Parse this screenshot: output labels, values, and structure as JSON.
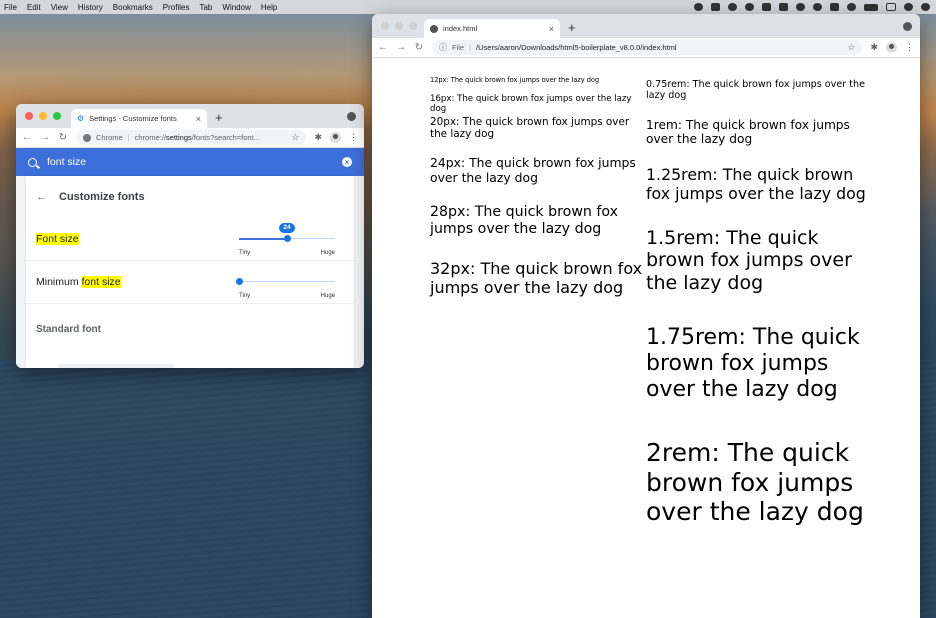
{
  "menubar": {
    "items": [
      "File",
      "Edit",
      "View",
      "History",
      "Bookmarks",
      "Profiles",
      "Tab",
      "Window",
      "Help"
    ],
    "status_icons": [
      "screen-share-icon",
      "dropbox-icon",
      "creative-cloud-icon",
      "gear-icon",
      "app-icon",
      "app-icon",
      "brightness-icon",
      "play-icon",
      "bluetooth-icon",
      "wifi-icon",
      "battery-icon",
      "control-center-icon",
      "search-icon",
      "avatar-icon"
    ]
  },
  "settings_window": {
    "tab_title": "Settings - Customize fonts",
    "omnibox_scheme": "Chrome",
    "omnibox_prefix": "chrome://",
    "omnibox_host": "settings",
    "omnibox_path": "/fonts?search=font...",
    "search_query": "font size",
    "heading": "Customize fonts",
    "font_size": {
      "label": "Font size",
      "value": "24",
      "value_fraction": 0.5,
      "min_label": "Tiny",
      "max_label": "Huge"
    },
    "minimum_font_size": {
      "label_prefix": "Minimum ",
      "label_highlight": "font size",
      "value_fraction": 0.0,
      "min_label": "Tiny",
      "max_label": "Huge"
    },
    "standard_font_heading": "Standard font"
  },
  "page_window": {
    "tab_title": "index.html",
    "omnibox_scheme": "File",
    "url": "/Users/aaron/Downloads/html5-boilerplate_v8.0.0/index.html",
    "px_samples": [
      "12px: The quick brown fox jumps over the lazy dog",
      "16px: The quick brown fox jumps over the lazy dog",
      "20px: The quick brown fox jumps over the lazy dog",
      "24px: The quick brown fox jumps over the lazy dog",
      "28px: The quick brown fox jumps over the lazy dog",
      "32px: The quick brown fox jumps over the lazy dog"
    ],
    "rem_samples": [
      "0.75rem: The quick brown fox jumps over the lazy dog",
      "1rem: The quick brown fox jumps over the lazy dog",
      "1.25rem: The quick brown fox jumps over the lazy dog",
      "1.5rem: The quick brown fox jumps over the lazy dog",
      "1.75rem: The quick brown fox jumps over the lazy dog",
      "2rem: The quick brown fox jumps over the lazy dog"
    ]
  },
  "colors": {
    "accent": "#1a73e8",
    "search_bar": "#3c6fd9",
    "highlight": "#ffff00",
    "light_close": "#ff5f57",
    "light_min": "#febc2e",
    "light_max": "#28c840",
    "light_inactive": "#cfcfcf"
  }
}
